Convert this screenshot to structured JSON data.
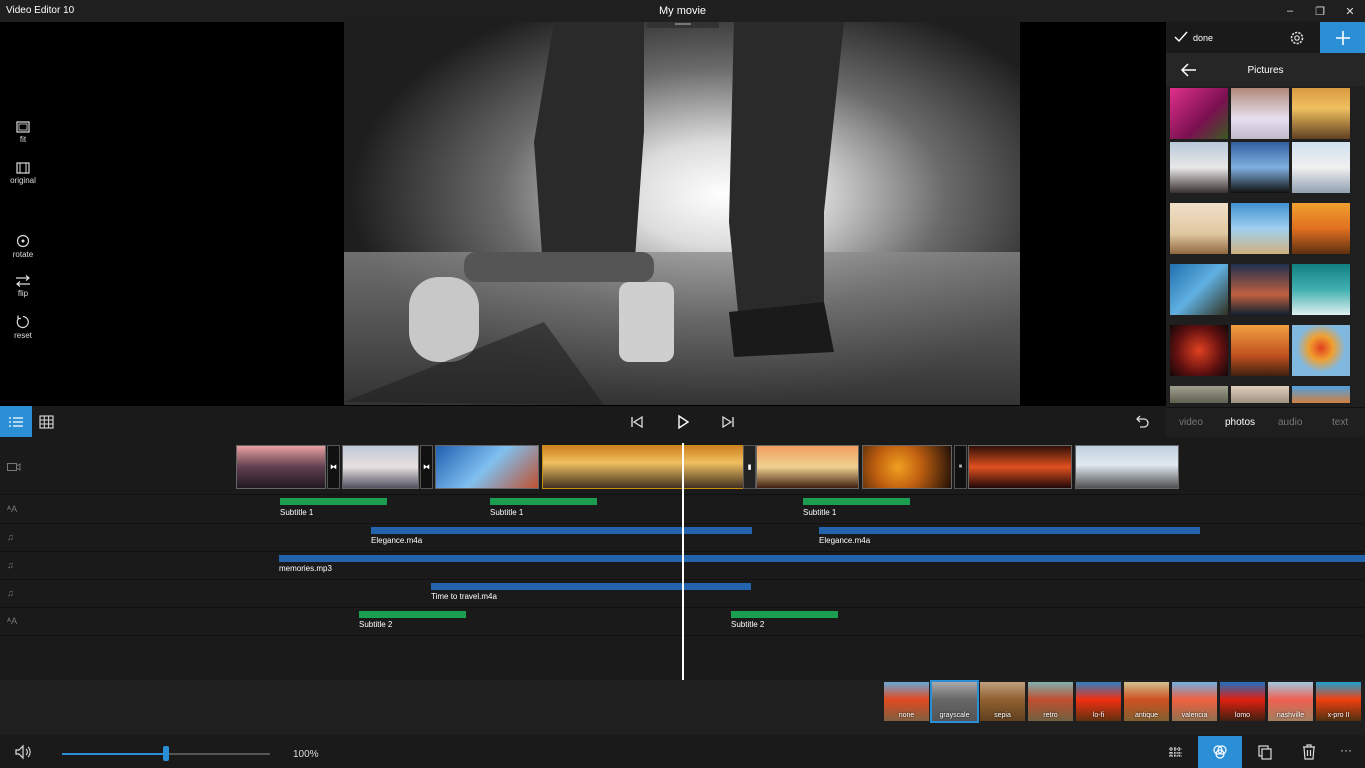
{
  "titlebar": {
    "app_title": "Video Editor 10",
    "movie_title": "My movie",
    "minimize": "–",
    "maximize": "❐",
    "close": "✕"
  },
  "left_tools": [
    {
      "label": "fit",
      "icon": "fit-icon"
    },
    {
      "label": "original",
      "icon": "original-icon"
    },
    {
      "label": "rotate",
      "icon": "rotate-icon"
    },
    {
      "label": "flip",
      "icon": "flip-icon"
    },
    {
      "label": "reset",
      "icon": "reset-icon"
    }
  ],
  "right_panel": {
    "done_label": "done",
    "pictures_title": "Pictures",
    "tabs": [
      {
        "label": "video",
        "active": false
      },
      {
        "label": "photos",
        "active": true
      },
      {
        "label": "audio",
        "active": false
      },
      {
        "label": "text",
        "active": false
      }
    ]
  },
  "timeline": {
    "text_tracks": [
      {
        "labels": [
          "Subtitle 1",
          "Subtitle 1",
          "Subtitle 1"
        ]
      },
      {
        "labels": [
          "Subtitle 2",
          "Subtitle 2"
        ]
      }
    ],
    "audio_tracks": [
      {
        "labels": [
          "Elegance.m4a",
          "Elegance.m4a"
        ]
      },
      {
        "labels": [
          "memories.mp3"
        ]
      },
      {
        "labels": [
          "Time to travel.m4a"
        ]
      }
    ]
  },
  "filters": [
    "none",
    "grayscale",
    "sepia",
    "retro",
    "lo-fi",
    "antique",
    "valencia",
    "lomo",
    "nashville",
    "x-pro II"
  ],
  "selected_filter": "grayscale",
  "zoom": {
    "value_label": "100%",
    "slider_fraction": 0.5
  },
  "colors": {
    "accent": "#2b8fd6",
    "subtitle_bar": "#1b9e50",
    "audio_bar": "#2463ad"
  }
}
